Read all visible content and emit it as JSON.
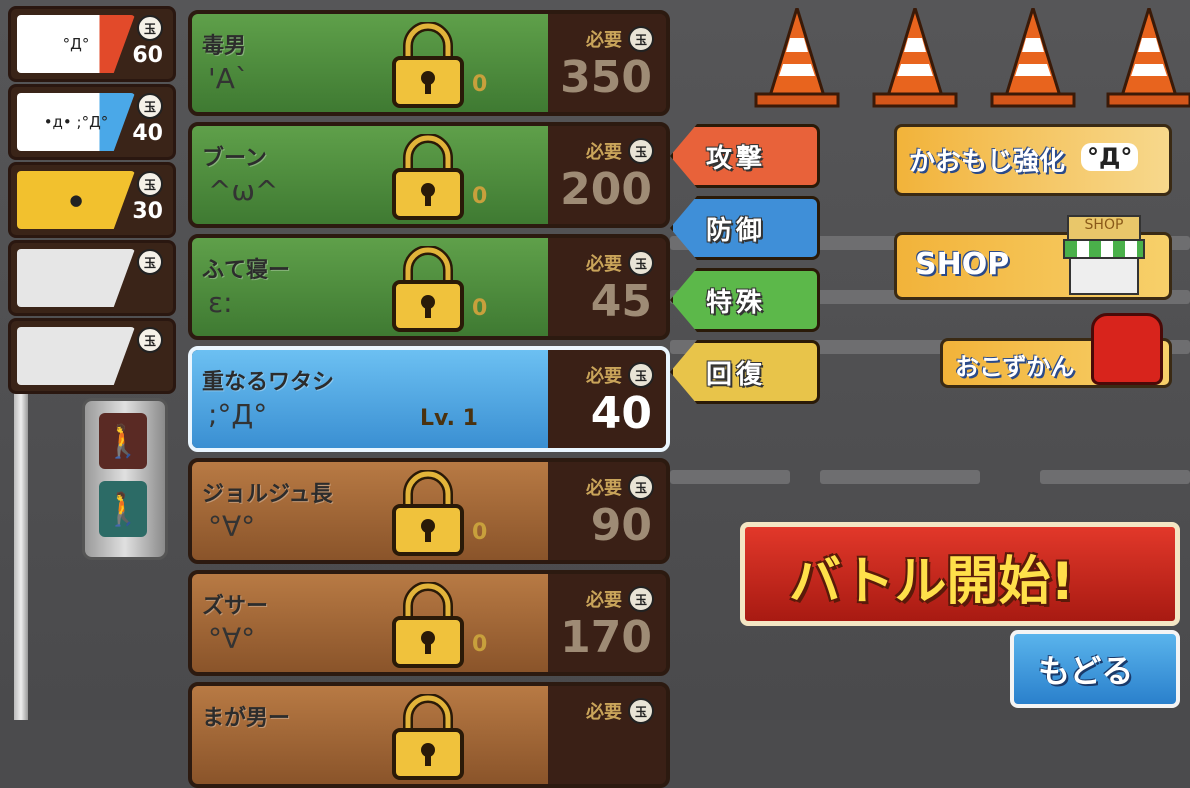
{
  "sidebar_slots": [
    {
      "face": "°Д°",
      "cost": "60",
      "card_color": "#ffffff",
      "accent": "#e24a2a"
    },
    {
      "face": "•д•  ;°Д°",
      "cost": "40",
      "card_color": "#ffffff",
      "accent": "#4aa8e8"
    },
    {
      "face": "●",
      "cost": "30",
      "card_color": "#f2c12e",
      "accent": "#f2c12e"
    },
    {
      "face": "",
      "cost": "",
      "card_color": "#e6e6e6",
      "accent": "#e6e6e6"
    },
    {
      "face": "",
      "cost": "",
      "card_color": "#e6e6e6",
      "accent": "#e6e6e6"
    }
  ],
  "tama_label": "玉",
  "need_label": "必要",
  "characters": [
    {
      "name": "毒男",
      "face": "'A`",
      "cost": "350",
      "owned": "0",
      "locked": true,
      "style": "green"
    },
    {
      "name": "ブーン",
      "face": "^ω^",
      "cost": "200",
      "owned": "0",
      "locked": true,
      "style": "green"
    },
    {
      "name": "ふて寝ー",
      "face": "ε:",
      "cost": "45",
      "owned": "0",
      "locked": true,
      "style": "green"
    },
    {
      "name": "重なるワタシ",
      "face": ";°Д°",
      "cost": "40",
      "level": "Lv. 1",
      "locked": false,
      "style": "blue"
    },
    {
      "name": "ジョルジュ長",
      "face": "°∀°",
      "cost": "90",
      "owned": "0",
      "locked": true,
      "style": "brown"
    },
    {
      "name": "ズサー",
      "face": "°∀°",
      "cost": "170",
      "owned": "0",
      "locked": true,
      "style": "brown"
    },
    {
      "name": "まが男ー",
      "face": "",
      "cost": "",
      "owned": "",
      "locked": true,
      "style": "brown"
    }
  ],
  "categories": [
    {
      "label": "攻撃",
      "color": "#e8623a"
    },
    {
      "label": "防御",
      "color": "#3f8fd8"
    },
    {
      "label": "特殊",
      "color": "#5cb84a"
    },
    {
      "label": "回復",
      "color": "#e8c44a"
    }
  ],
  "buttons": {
    "omoji": "かおもじ強化",
    "omoji_face": "°Д°",
    "shop": "SHOP",
    "shop_sign": "SHOP",
    "okozukan": "おこずかん",
    "battle": "バトル開始!",
    "back": "もどる"
  }
}
